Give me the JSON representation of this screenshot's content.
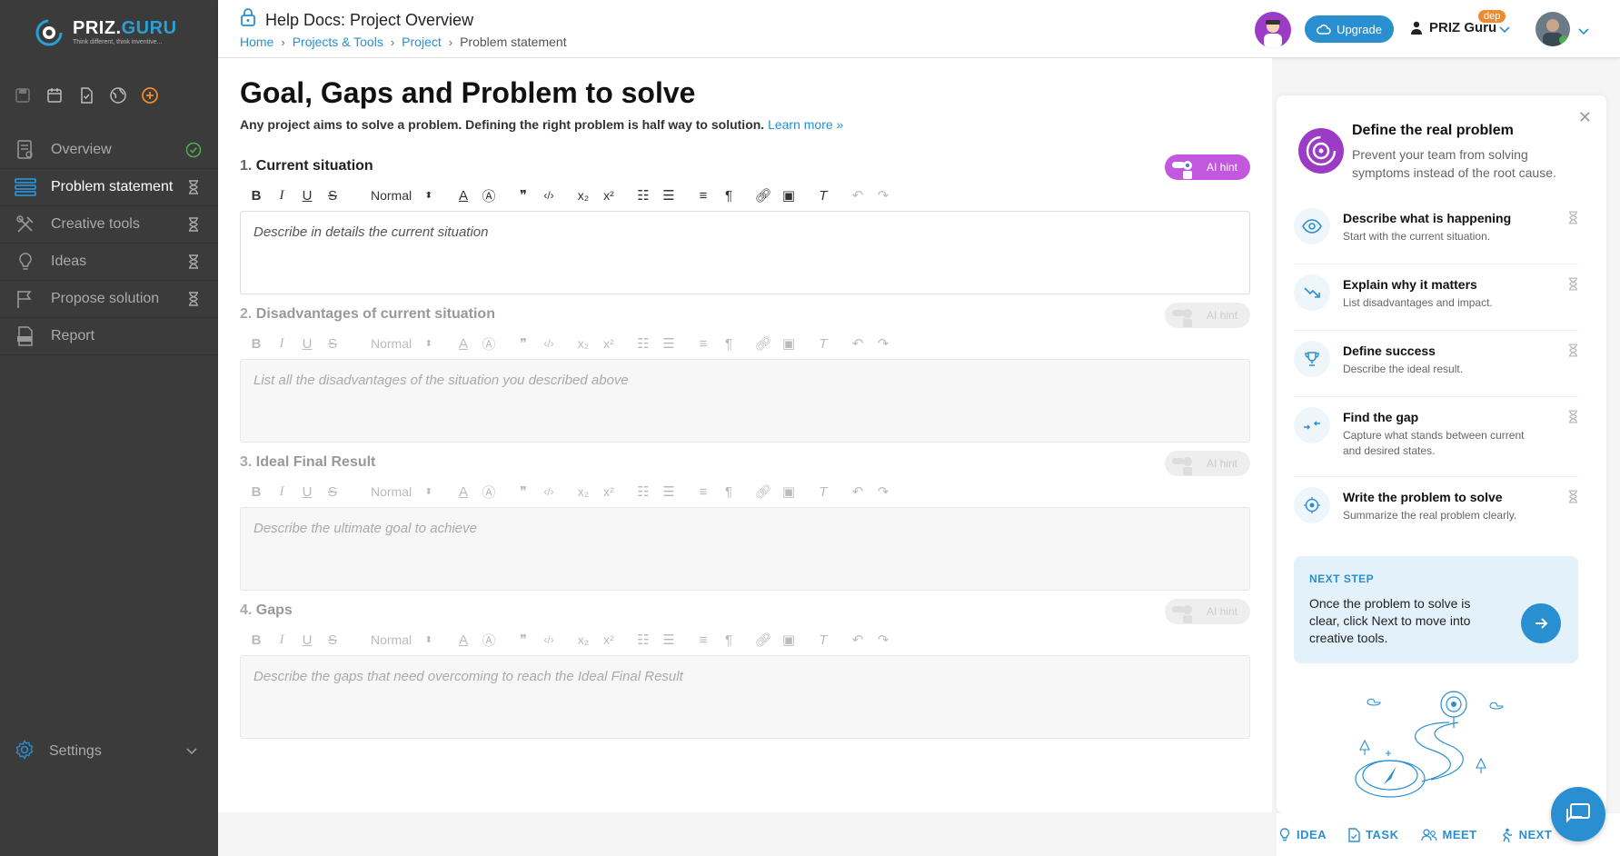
{
  "brand": {
    "logo_prefix": "PRIZ.",
    "logo_suffix": "GURU",
    "tagline": "Think different, think inventive..."
  },
  "colors": {
    "accent": "#2a8fd0",
    "ai_purple": "#c158de",
    "sidebar_bg": "#3b3b3b",
    "success": "#4caf50",
    "badge_orange": "#f08a2c"
  },
  "sidebar": {
    "quick_icons": [
      "save-icon",
      "calendar-icon",
      "document-check-icon",
      "globe-icon",
      "add-circle-icon"
    ],
    "items": [
      {
        "label": "Overview",
        "icon": "overview-doc-icon",
        "status": "done"
      },
      {
        "label": "Problem statement",
        "icon": "stack-icon",
        "status": "pending",
        "active": true
      },
      {
        "label": "Creative tools",
        "icon": "tools-icon",
        "status": "pending"
      },
      {
        "label": "Ideas",
        "icon": "lightbulb-icon",
        "status": "pending"
      },
      {
        "label": "Propose solution",
        "icon": "flag-icon",
        "status": "pending"
      },
      {
        "label": "Report",
        "icon": "pdf-icon",
        "status": ""
      }
    ],
    "settings_label": "Settings"
  },
  "header": {
    "title": "Help Docs: Project Overview",
    "breadcrumb": {
      "home": "Home",
      "projects": "Projects & Tools",
      "project": "Project",
      "current": "Problem statement"
    },
    "upgrade_label": "Upgrade",
    "user_name": "PRIZ Guru",
    "env_badge": "dep"
  },
  "main": {
    "title": "Goal, Gaps and Problem to solve",
    "subtitle": "Any project aims to solve a problem. Defining the right problem is half way to solution.",
    "learn_more": "Learn more »",
    "ai_hint_label": "AI hint",
    "format_select": "Normal",
    "sections": [
      {
        "num": "1.",
        "title": "Current situation",
        "placeholder": "Describe in details the current situation",
        "enabled": true
      },
      {
        "num": "2.",
        "title": "Disadvantages of current situation",
        "placeholder": "List all the disadvantages of the situation you described above",
        "enabled": false
      },
      {
        "num": "3.",
        "title": "Ideal Final Result",
        "placeholder": "Describe the ultimate goal to achieve",
        "enabled": false
      },
      {
        "num": "4.",
        "title": "Gaps",
        "placeholder": "Describe the gaps that need overcoming to reach the Ideal Final Result",
        "enabled": false
      }
    ]
  },
  "panel": {
    "hero_title": "Define the real problem",
    "hero_desc": "Prevent your team from solving symptoms instead of the root cause.",
    "steps": [
      {
        "title": "Describe what is happening",
        "desc": "Start with the current situation.",
        "icon": "eye-icon"
      },
      {
        "title": "Explain why it matters",
        "desc": "List disadvantages and impact.",
        "icon": "trend-down-icon"
      },
      {
        "title": "Define success",
        "desc": "Describe the ideal result.",
        "icon": "trophy-icon"
      },
      {
        "title": "Find the gap",
        "desc": "Capture what stands between current and desired states.",
        "icon": "gap-arrows-icon"
      },
      {
        "title": "Write the problem to solve",
        "desc": "Summarize the real problem clearly.",
        "icon": "target-icon"
      }
    ],
    "next_label": "NEXT STEP",
    "next_text": "Once the problem to solve is clear, click Next to move into creative tools."
  },
  "bottom_bar": {
    "idea": "IDEA",
    "task": "TASK",
    "meet": "MEET",
    "next": "NEXT"
  }
}
